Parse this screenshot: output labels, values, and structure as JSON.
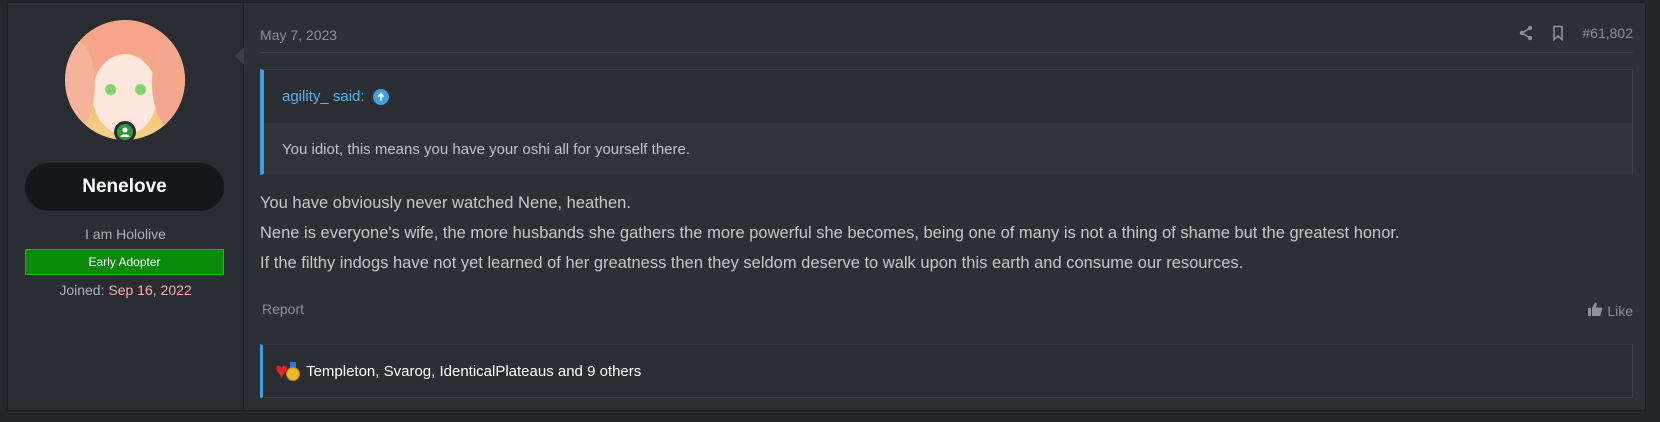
{
  "user": {
    "name": "Nenelove",
    "title": "I am Hololive",
    "banner": "Early Adopter",
    "joined_label": "Joined:",
    "joined_date": "Sep 16, 2022"
  },
  "post": {
    "date": "May 7, 2023",
    "number": "#61,802",
    "quote": {
      "author": "agility_ said:",
      "text": "You idiot, this means you have your oshi all for yourself there."
    },
    "body": [
      "You have obviously never watched Nene, heathen.",
      "Nene is everyone's wife, the more husbands she gathers the more powerful she becomes, being one of many is not a thing of shame but the greatest honor.",
      "If the filthy indogs have not yet learned of her greatness then they seldom deserve to walk upon this earth and consume our resources."
    ],
    "report_label": "Report",
    "like_label": "Like",
    "reactions_text": "Templeton, Svarog, IdenticalPlateaus and 9 others"
  },
  "icons": [
    "share-icon",
    "bookmark-icon",
    "online-user-icon",
    "arrow-up-circle-icon",
    "thumbs-up-icon",
    "heart-icon",
    "medal-icon"
  ],
  "colors": {
    "accent": "#3fa0dc",
    "banner": "#0a8a0a",
    "joined_date": "#f6b1b1"
  }
}
